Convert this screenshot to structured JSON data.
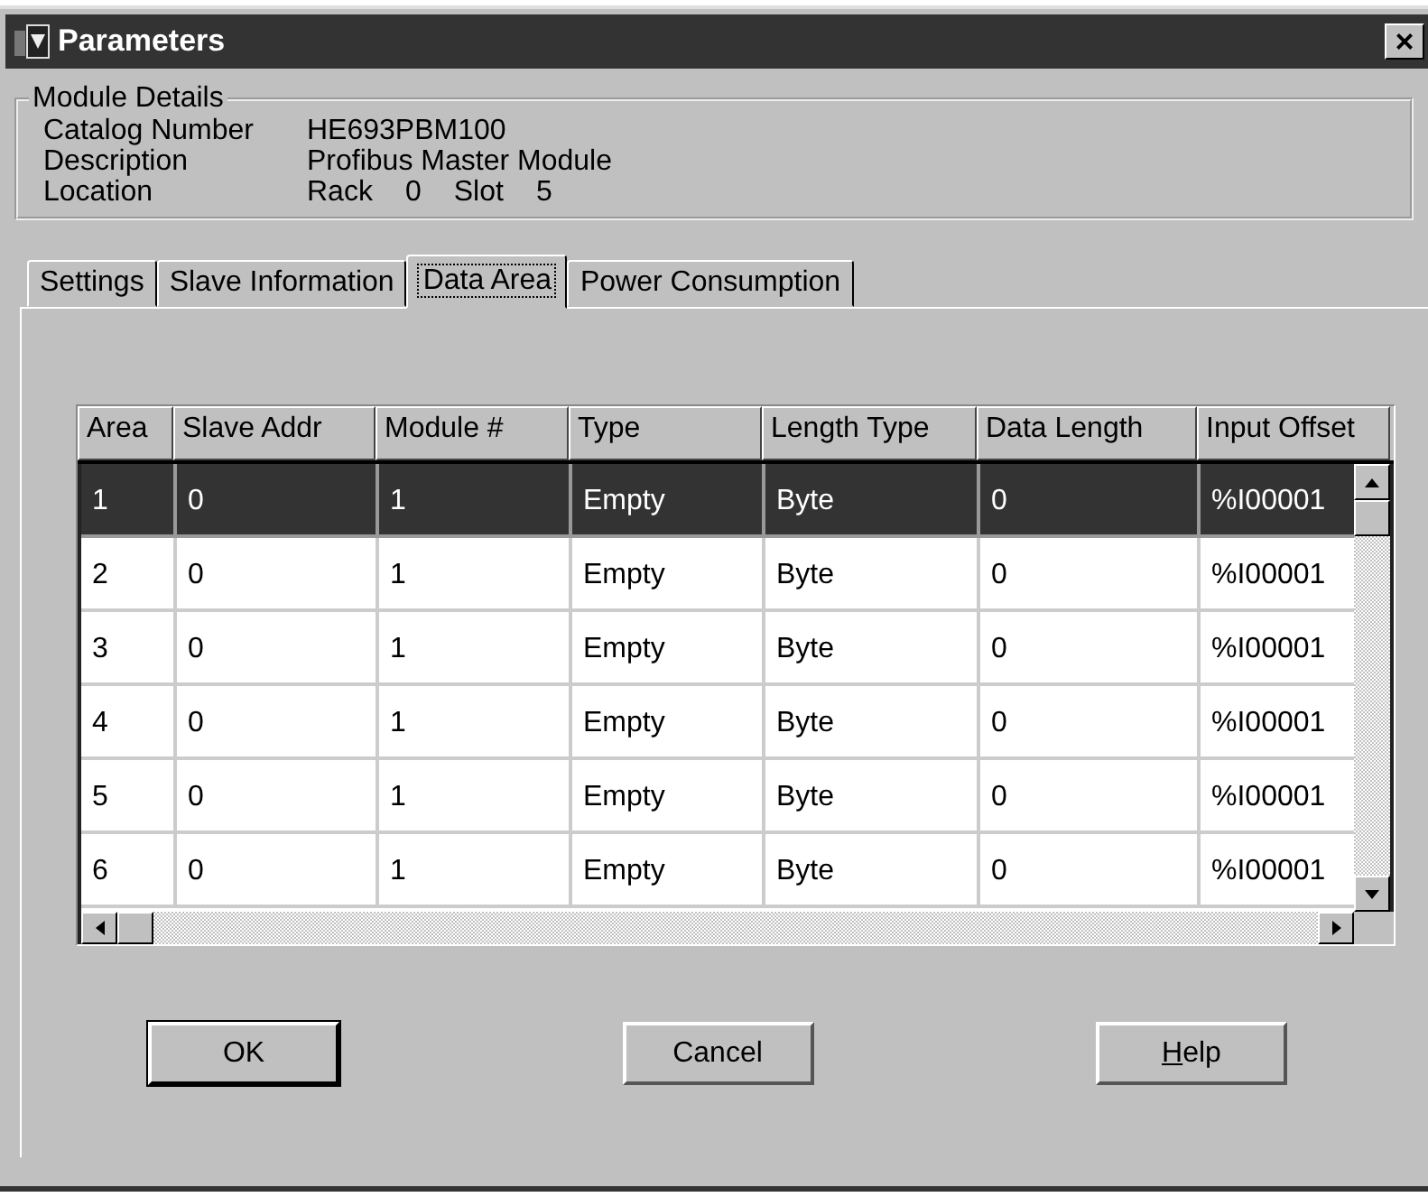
{
  "window": {
    "title": "Parameters",
    "close": "×"
  },
  "module_details": {
    "title": "Module Details",
    "rows": [
      {
        "label": "Catalog Number",
        "value": "HE693PBM100"
      },
      {
        "label": "Description",
        "value": "Profibus Master Module"
      },
      {
        "label": "Location",
        "parts": [
          "Rack",
          "0",
          "Slot",
          "5"
        ]
      }
    ]
  },
  "tabs": [
    {
      "label": "Settings",
      "selected": false
    },
    {
      "label": "Slave Information",
      "selected": false
    },
    {
      "label": "Data Area",
      "selected": true
    },
    {
      "label": "Power Consumption",
      "selected": false
    }
  ],
  "table": {
    "columns": [
      "Area",
      "Slave Addr",
      "Module #",
      "Type",
      "Length Type",
      "Data Length",
      "Input Offset"
    ],
    "rows": [
      {
        "cells": [
          "1",
          "0",
          "1",
          "Empty",
          "Byte",
          "0",
          "%I00001"
        ],
        "selected": true
      },
      {
        "cells": [
          "2",
          "0",
          "1",
          "Empty",
          "Byte",
          "0",
          "%I00001"
        ],
        "selected": false
      },
      {
        "cells": [
          "3",
          "0",
          "1",
          "Empty",
          "Byte",
          "0",
          "%I00001"
        ],
        "selected": false
      },
      {
        "cells": [
          "4",
          "0",
          "1",
          "Empty",
          "Byte",
          "0",
          "%I00001"
        ],
        "selected": false
      },
      {
        "cells": [
          "5",
          "0",
          "1",
          "Empty",
          "Byte",
          "0",
          "%I00001"
        ],
        "selected": false
      },
      {
        "cells": [
          "6",
          "0",
          "1",
          "Empty",
          "Byte",
          "0",
          "%I00001"
        ],
        "selected": false
      }
    ]
  },
  "buttons": [
    {
      "label": "OK",
      "default": true,
      "underline_first": false
    },
    {
      "label": "Cancel",
      "default": false,
      "underline_first": false
    },
    {
      "label": "Help",
      "default": false,
      "underline_first": true
    }
  ]
}
